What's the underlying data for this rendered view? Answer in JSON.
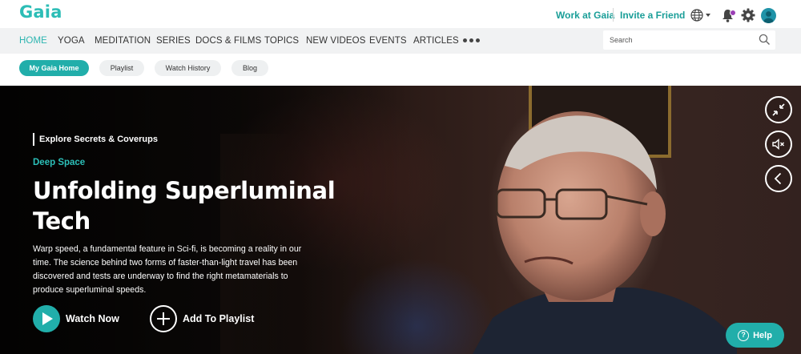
{
  "brand": {
    "logo_text": "Gaia",
    "accent_color": "#2cbdb6",
    "button_color": "#21aeaa"
  },
  "topbar": {
    "work_link": "Work at Gaia",
    "invite_link": "Invite a Friend",
    "icons": [
      "globe-icon",
      "bell-icon",
      "gear-icon",
      "avatar"
    ]
  },
  "nav": {
    "items": [
      "HOME",
      "YOGA",
      "MEDITATION",
      "SERIES",
      "DOCS & FILMS",
      "TOPICS",
      "NEW VIDEOS",
      "EVENTS",
      "ARTICLES"
    ],
    "active": "HOME",
    "search_placeholder": "Search"
  },
  "subnav": {
    "pills": [
      "My Gaia Home",
      "Playlist",
      "Watch History",
      "Blog"
    ],
    "active": "My Gaia Home"
  },
  "hero": {
    "kicker": "Explore Secrets & Coverups",
    "series": "Deep Space",
    "title": "Unfolding Superluminal Tech",
    "description": "Warp speed, a fundamental feature in Sci-fi, is becoming a reality in our time. The science behind two forms of faster-than-light travel has been discovered and tests are underway to find the right metamaterials to produce superluminal speeds.",
    "watch_label": "Watch Now",
    "playlist_label": "Add To Playlist"
  },
  "help": {
    "label": "Help"
  }
}
